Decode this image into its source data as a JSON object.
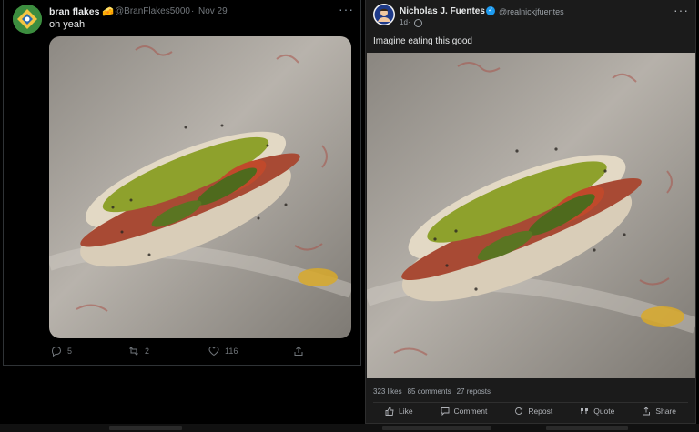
{
  "left_post": {
    "display_name": "bran flakes 🧀",
    "handle": "@BranFlakes5000",
    "separator": "·",
    "date": "Nov 29",
    "more": "···",
    "text": "oh yeah",
    "actions": {
      "replies": "5",
      "reposts": "2",
      "likes": "116"
    }
  },
  "right_post": {
    "display_name": "Nicholas J. Fuentes",
    "handle": "@realnickjfuentes",
    "time": "1d",
    "separator": "·",
    "more": "···",
    "text": "Imagine eating this good",
    "stats": {
      "likes": "323 likes",
      "comments": "85 comments",
      "reposts": "27 reposts"
    },
    "actions": {
      "like": "Like",
      "comment": "Comment",
      "repost": "Repost",
      "quote": "Quote",
      "share": "Share"
    }
  },
  "colors": {
    "verified": "#1d9bf0",
    "muted": "#71767b"
  }
}
